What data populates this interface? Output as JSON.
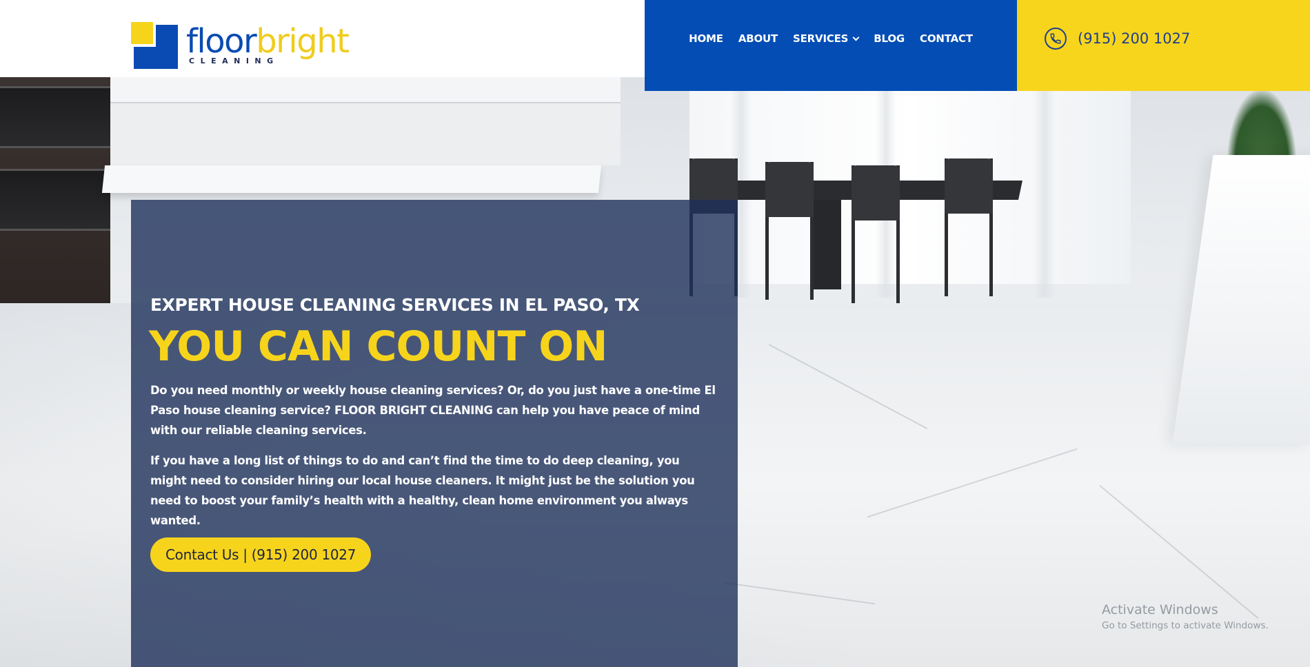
{
  "brand": {
    "logo_word_part1": "floor",
    "logo_word_part2": "bright",
    "logo_sub": "CLEANING",
    "colors": {
      "blue": "#034db5",
      "yellow": "#f7d41c",
      "navy": "#1f3f8a"
    }
  },
  "nav": {
    "items": [
      {
        "label": "HOME"
      },
      {
        "label": "ABOUT"
      },
      {
        "label": "SERVICES",
        "has_dropdown": true
      },
      {
        "label": "BLOG"
      },
      {
        "label": "CONTACT"
      }
    ]
  },
  "header": {
    "phone_icon": "phone-icon",
    "phone": "(915) 200 1027"
  },
  "hero": {
    "subtitle": "EXPERT HOUSE CLEANING SERVICES IN EL PASO, TX",
    "title": "YOU CAN COUNT ON",
    "paragraph1": "Do you need monthly or weekly house cleaning services? Or, do you just have a one-time El Paso house cleaning service? FLOOR BRIGHT CLEANING can help you have peace of mind with our reliable cleaning services.",
    "paragraph2": "If you have a long list of things to do and can’t find the time to do deep cleaning, you might need to consider hiring our local house cleaners. It might just be the solution you need to boost your family’s health with a healthy, clean home environment you always wanted.",
    "cta_label": "Contact Us | (915) 200 1027"
  },
  "watermark": {
    "line1": "Activate Windows",
    "line2": "Go to Settings to activate Windows."
  }
}
